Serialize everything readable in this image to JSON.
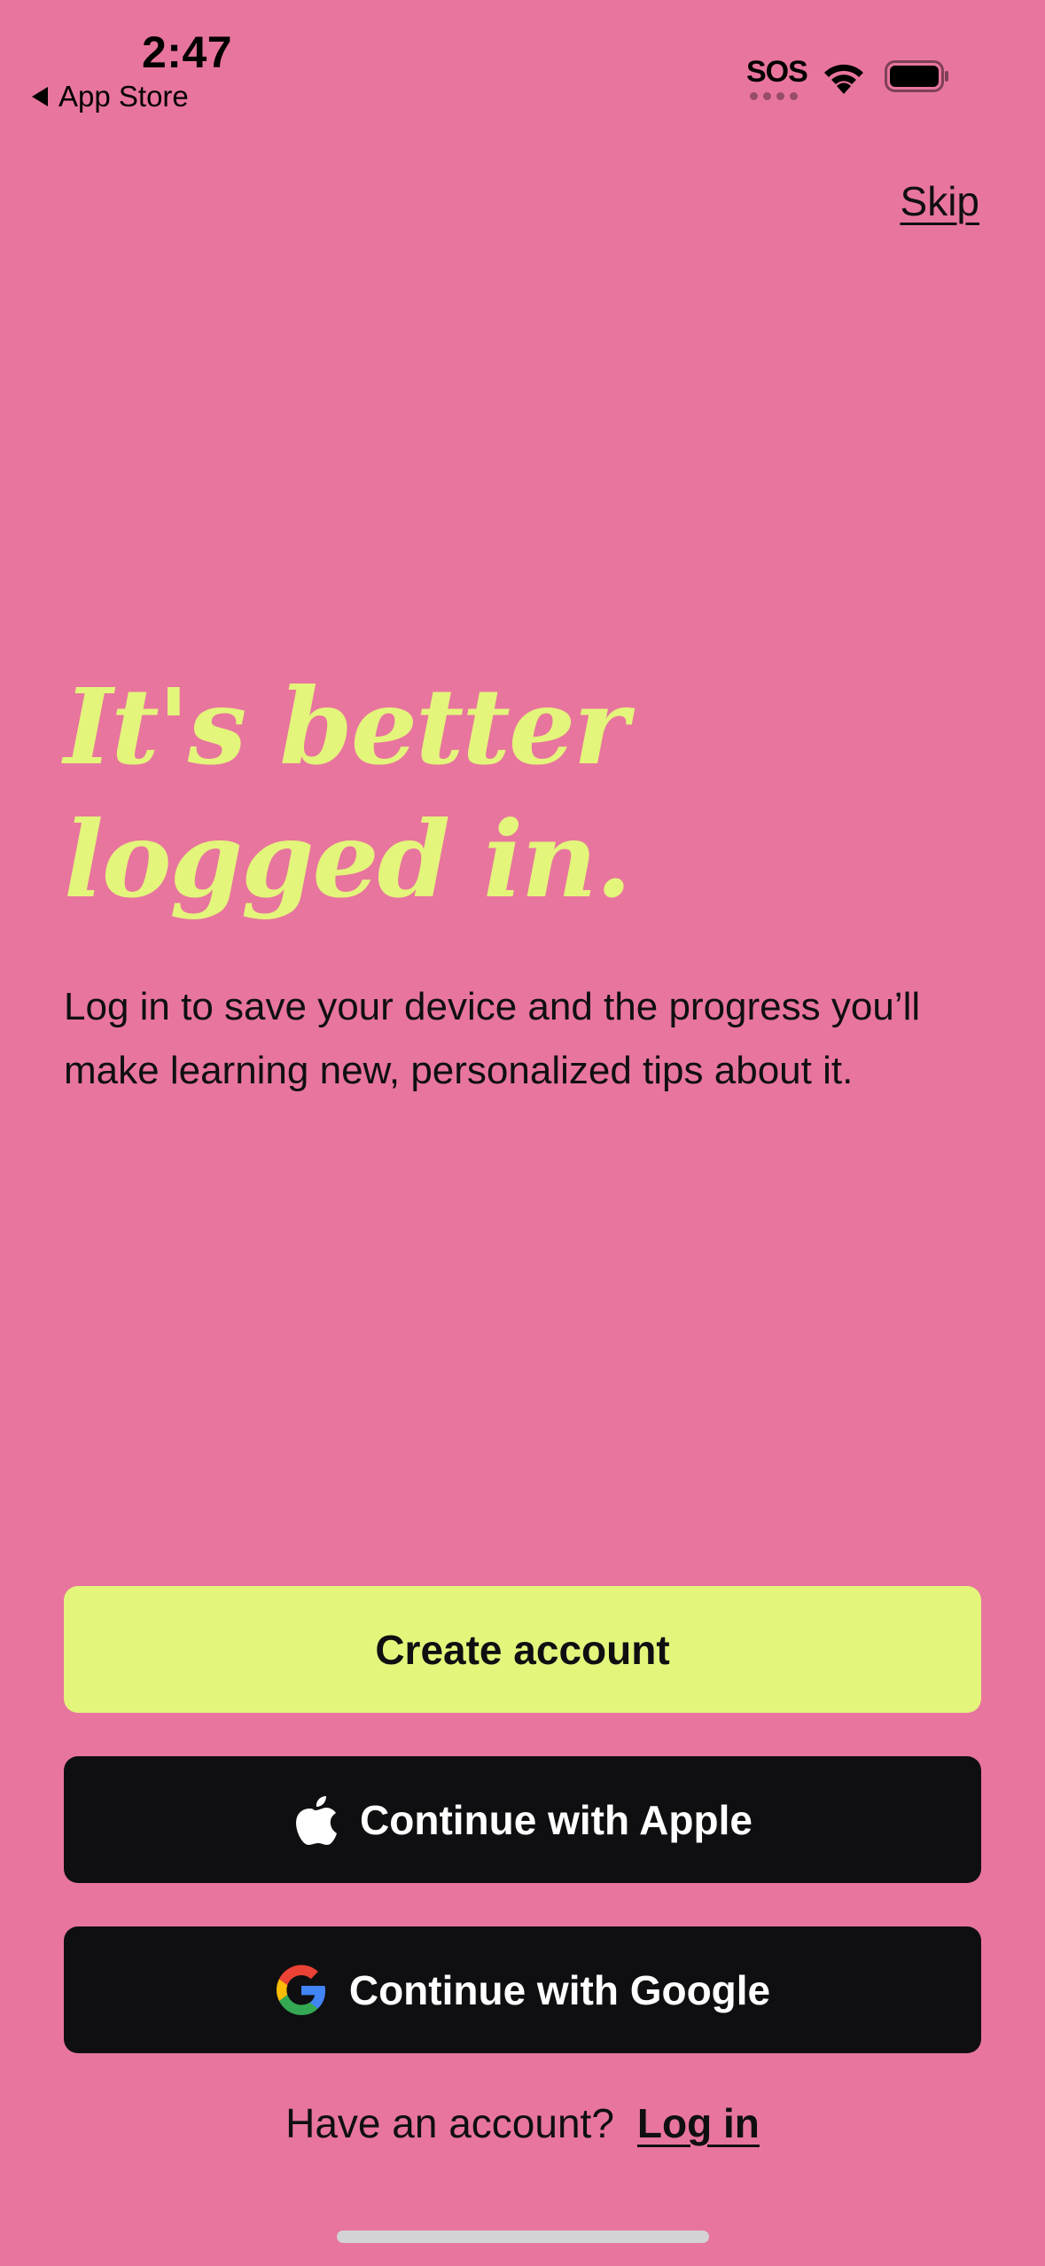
{
  "status_bar": {
    "time": "2:47",
    "back_label": "App Store",
    "sos": "SOS",
    "icons": [
      "back-arrow-icon",
      "wifi-icon",
      "battery-icon"
    ]
  },
  "header": {
    "skip_label": "Skip"
  },
  "hero": {
    "headline_line1": "It's better",
    "headline_line2": "logged in.",
    "description": "Log in to save your device and the progress you’ll make learning new, personalized tips about it."
  },
  "actions": {
    "create_label": "Create account",
    "apple_label": "Continue with Apple",
    "google_label": "Continue with Google",
    "apple_icon": "apple-logo-icon",
    "google_icon": "google-logo-icon"
  },
  "footer": {
    "have_account": "Have an account?",
    "login_label": "Log in"
  },
  "colors": {
    "background": "#E8759E",
    "accent_yellow": "#E3F57B",
    "dark": "#0F0F12",
    "white": "#FFFFFF"
  }
}
